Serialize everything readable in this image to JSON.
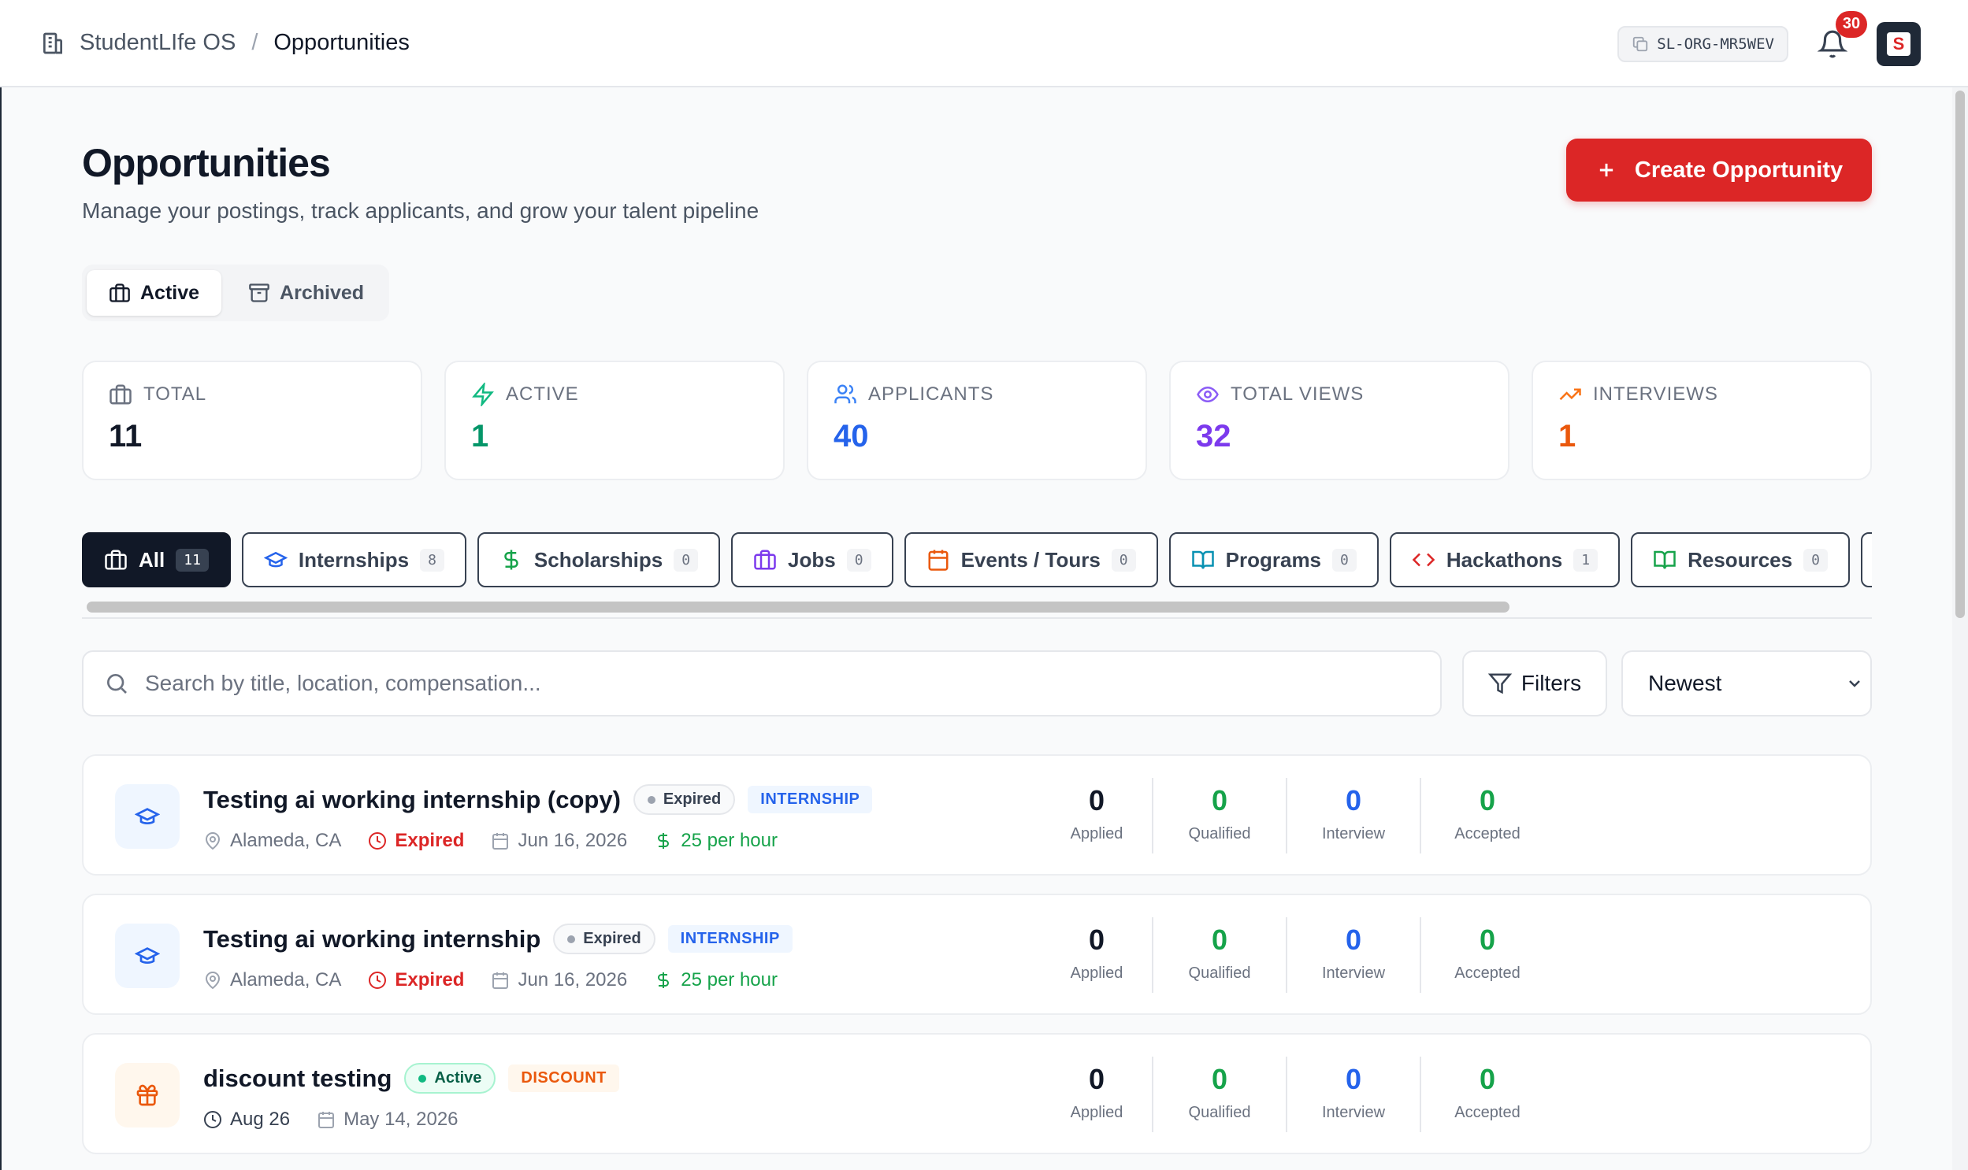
{
  "header": {
    "org": "StudentLIfe OS",
    "separator": "/",
    "current": "Opportunities",
    "org_code": "SL-ORG-MR5WEV",
    "notifications": "30"
  },
  "page": {
    "title": "Opportunities",
    "subtitle": "Manage your postings, track applicants, and grow your talent pipeline",
    "create_label": "Create Opportunity"
  },
  "view_toggle": {
    "active": "Active",
    "archived": "Archived"
  },
  "stats": [
    {
      "label": "TOTAL",
      "value": "11",
      "color": "#111827"
    },
    {
      "label": "ACTIVE",
      "value": "1",
      "color": "#059669"
    },
    {
      "label": "APPLICANTS",
      "value": "40",
      "color": "#2563eb"
    },
    {
      "label": "TOTAL VIEWS",
      "value": "32",
      "color": "#7c3aed"
    },
    {
      "label": "INTERVIEWS",
      "value": "1",
      "color": "#ea580c"
    }
  ],
  "tabs": [
    {
      "label": "All",
      "count": "11"
    },
    {
      "label": "Internships",
      "count": "8"
    },
    {
      "label": "Scholarships",
      "count": "0"
    },
    {
      "label": "Jobs",
      "count": "0"
    },
    {
      "label": "Events / Tours",
      "count": "0"
    },
    {
      "label": "Programs",
      "count": "0"
    },
    {
      "label": "Hackathons",
      "count": "1"
    },
    {
      "label": "Resources",
      "count": "0"
    }
  ],
  "search": {
    "placeholder": "Search by title, location, compensation..."
  },
  "filters_label": "Filters",
  "sort_value": "Newest",
  "metric_labels": {
    "applied": "Applied",
    "qualified": "Qualified",
    "interview": "Interview",
    "accepted": "Accepted"
  },
  "cards": [
    {
      "title": "Testing ai working internship (copy)",
      "status": "Expired",
      "type": "INTERNSHIP",
      "location": "Alameda, CA",
      "deadline": "Expired",
      "date": "Jun 16, 2026",
      "pay": "25 per hour",
      "applied": "0",
      "qualified": "0",
      "interview": "0",
      "accepted": "0"
    },
    {
      "title": "Testing ai working internship",
      "status": "Expired",
      "type": "INTERNSHIP",
      "location": "Alameda, CA",
      "deadline": "Expired",
      "date": "Jun 16, 2026",
      "pay": "25 per hour",
      "applied": "0",
      "qualified": "0",
      "interview": "0",
      "accepted": "0"
    },
    {
      "title": "discount testing",
      "status": "Active",
      "type": "DISCOUNT",
      "deadline": "Aug 26",
      "date": "May 14, 2026",
      "applied": "0",
      "qualified": "0",
      "interview": "0",
      "accepted": "0"
    }
  ],
  "colors": {
    "brand": "#dc2626",
    "qualified": "#16a34a",
    "interview": "#2563eb",
    "accepted": "#16a34a"
  }
}
